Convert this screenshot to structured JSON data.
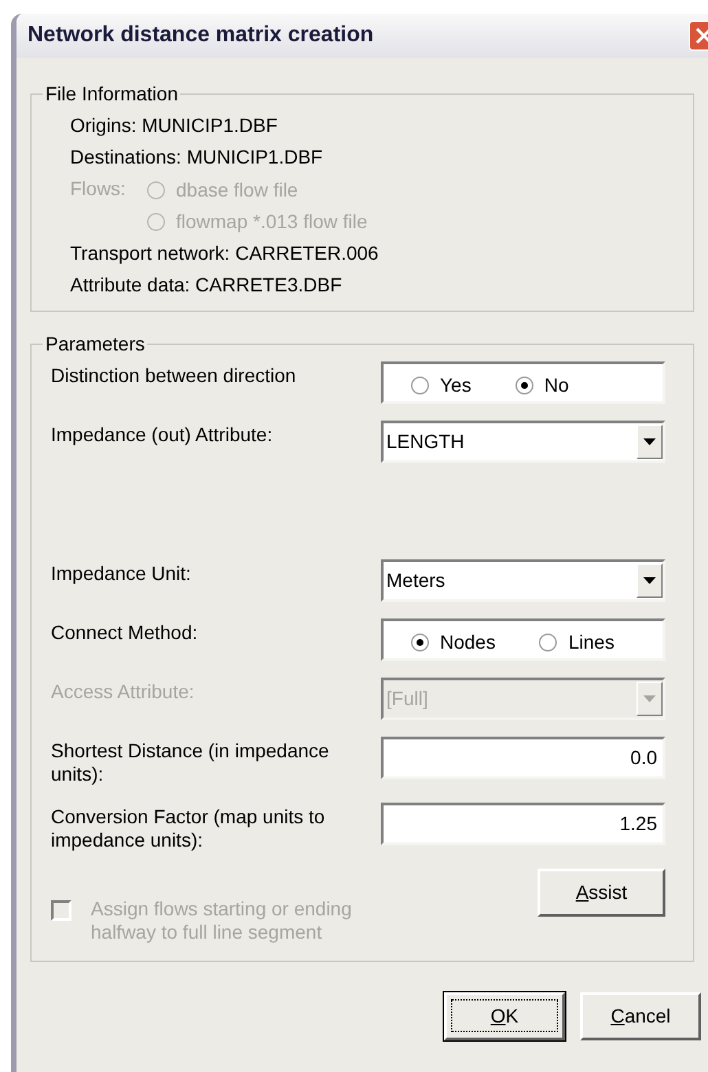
{
  "window": {
    "title": "Network distance matrix creation"
  },
  "file_information": {
    "title": "File Information",
    "lines": [
      {
        "kind": "text",
        "text": "Origins: MUNICIP1.DBF"
      },
      {
        "kind": "text",
        "text": "Destinations: MUNICIP1.DBF"
      },
      {
        "kind": "radio_group",
        "label": "Flows:",
        "disabled": true,
        "options": [
          {
            "label": "dbase flow file",
            "selected": false
          },
          {
            "label": "flowmap *.013 flow file",
            "selected": false
          }
        ]
      },
      {
        "kind": "text",
        "text": "Transport network: CARRETER.006"
      },
      {
        "kind": "text",
        "text": "Attribute data: CARRETE3.DBF"
      }
    ]
  },
  "parameters": {
    "title": "Parameters",
    "rows": [
      {
        "kind": "radio",
        "label": "Distinction between direction",
        "disabled": false,
        "options": [
          {
            "label": "Yes",
            "selected": false
          },
          {
            "label": "No",
            "selected": true
          }
        ]
      },
      {
        "kind": "dropdown",
        "label": "Impedance (out) Attribute:",
        "value": "LENGTH",
        "disabled": false
      },
      {
        "kind": "dropdown",
        "label": "Impedance Unit:",
        "value": "Meters",
        "disabled": false
      },
      {
        "kind": "radio",
        "label": "Connect Method:",
        "disabled": false,
        "options": [
          {
            "label": "Nodes",
            "selected": true
          },
          {
            "label": "Lines",
            "selected": false
          }
        ]
      },
      {
        "kind": "dropdown",
        "label": "Access Attribute:",
        "value": "[Full]",
        "disabled": true
      },
      {
        "kind": "number",
        "label": "Shortest Distance (in impedance units):",
        "value": "0.0",
        "disabled": false
      },
      {
        "kind": "number",
        "label": "Conversion Factor (map units to impedance units):",
        "value": "1.25",
        "disabled": false
      }
    ],
    "checkbox": {
      "label": "Assign flows starting or ending halfway to full line segment",
      "checked": false,
      "disabled": true
    },
    "assist_button": {
      "label": "Assist",
      "mnemonic": true
    }
  },
  "buttons": [
    {
      "label": "OK",
      "mnemonic": true,
      "default": true
    },
    {
      "label": "Cancel",
      "mnemonic": true,
      "default": false
    }
  ]
}
